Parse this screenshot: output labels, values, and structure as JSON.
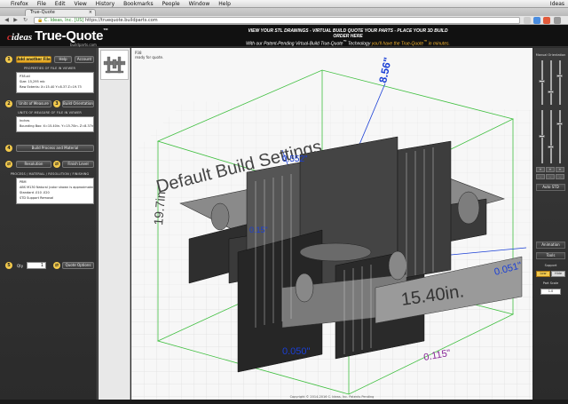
{
  "os_menu": {
    "items": [
      "Firefox",
      "File",
      "Edit",
      "View",
      "History",
      "Bookmarks",
      "People",
      "Window",
      "Help"
    ],
    "right_text": "Ideas"
  },
  "browser": {
    "tab_title": "True-Quote",
    "url_secure_text": "C. Ideas, Inc. [US]",
    "url": "https://truequote.buildparts.com"
  },
  "header": {
    "logo_ideas": "ideas",
    "logo_true_quote": "True-Quote",
    "logo_tm": "™",
    "logo_sub": "buildparts.com",
    "tagline_1": "VIEW YOUR STL DRAWINGS - VIRTUAL BUILD QUOTE YOUR PARTS - PLACE YOUR 3D BUILD ORDER HERE",
    "tagline_2_pre": "With our Patent-Pending Virtual-Build True-Quote",
    "tagline_2_hl": "you'll have the True-Quote",
    "tagline_2_post": "in minutes."
  },
  "left_panel": {
    "steps": [
      "1",
      "2",
      "3",
      "4",
      "5"
    ],
    "add_file_button": "Add another File",
    "help_button": "Help",
    "account_button": "Account",
    "properties_title": "PROPERTIES OF FILE IN VIEWER",
    "properties_lines": [
      "P38.stl",
      "Size: 15,295 mb",
      "Raw Extents: X=15.40   Y=8.37   Z=19.73"
    ],
    "units_button": "Units of Measure",
    "orientation_button": "Build Orientation",
    "units_title": "UNITS OF MEASURE OF FILE IN VIEWER",
    "units_lines": [
      "Inches",
      "Bounding Box:  X=15.40in.   Y=15.70in.   Z=8.37in."
    ],
    "process_button": "Build Process and Material",
    "resolution_button": "Resolution",
    "finish_button": "Finish Level",
    "process_title": "PROCESS / MATERIAL / RESOLUTION / FINISHING",
    "process_lines": [
      "PBM",
      "ABS M130 Natural   (color shown is approximated)",
      "Standard  .010 .020",
      "STD Support Removal"
    ],
    "qty_label": "Qty",
    "qty_value": "1",
    "quote_button": "Quote Options"
  },
  "viewport": {
    "status_line1": "P38",
    "status_line2": "ready for quote.",
    "footer": "Copyright © 2014-2016 C. Ideas, Inc. Patents Pending",
    "scene_label": "Default Build Settings",
    "dim_labels": [
      "8.56\"",
      "19.7in.",
      "0.552\"",
      "0.15\"",
      "15.40in.",
      "0.051\"",
      "0.050\"",
      "0.115\""
    ]
  },
  "right_panel": {
    "manual_title": "Manual Orientation",
    "slider_labels": [
      "X",
      "Y",
      "Z"
    ],
    "arrow_buttons": [
      "+",
      "-",
      "+",
      "-",
      "+",
      "-"
    ],
    "auto_button": "Auto STD",
    "animation_button": "Animation",
    "tools_button": "Tools",
    "support_title": "Support",
    "support_on": "Low",
    "support_off": "Hide",
    "part_scale_title": "Part Scale",
    "part_scale_value": "1.0"
  },
  "colors": {
    "accent_orange": "#f2c94c",
    "header_bg": "#111111",
    "panel_bg": "#2f2f2f",
    "dim_blue": "#1a3fd6",
    "grid_green": "#3fbf3f",
    "dim_purple": "#8a2a9a"
  }
}
